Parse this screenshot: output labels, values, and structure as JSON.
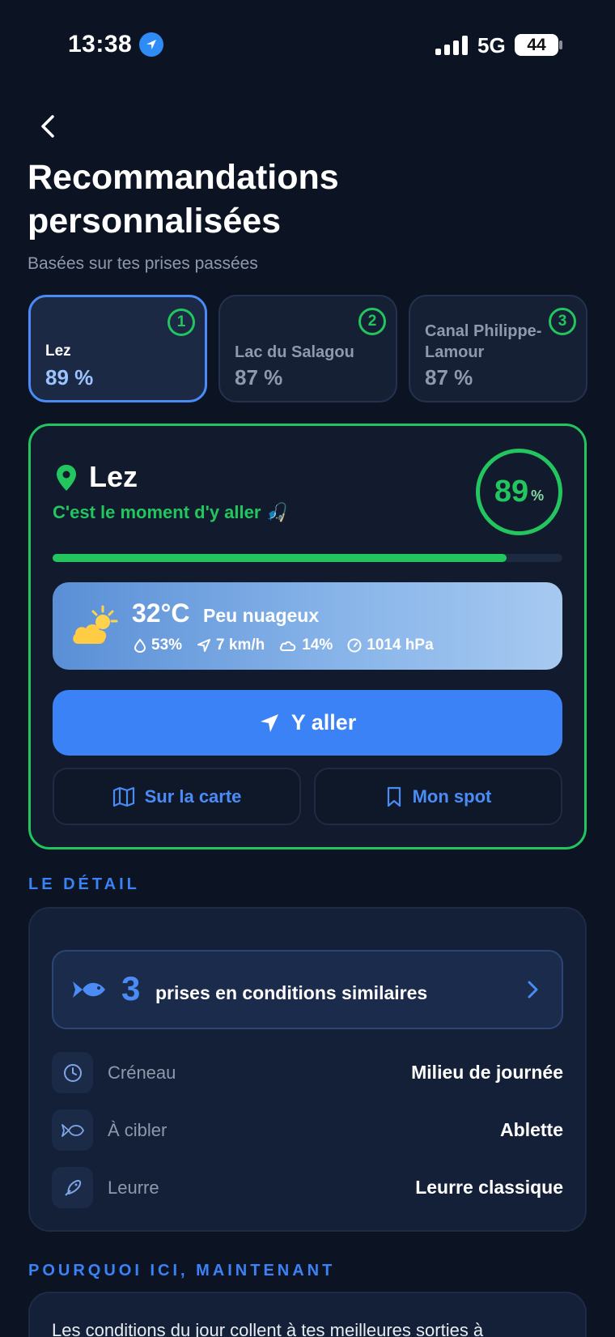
{
  "status_bar": {
    "time": "13:38",
    "network": "5G",
    "battery": "44"
  },
  "header": {
    "title": "Recommandations personnalisées",
    "subtitle": "Basées sur tes prises passées"
  },
  "spots": [
    {
      "rank": "1",
      "name": "Lez",
      "score": "89 %",
      "active": true
    },
    {
      "rank": "2",
      "name": "Lac du Salagou",
      "score": "87 %",
      "active": false
    },
    {
      "rank": "3",
      "name": "Canal Philippe-Lamour",
      "score": "87 %",
      "active": false
    }
  ],
  "selected": {
    "name": "Lez",
    "message": "C'est le moment d'y aller",
    "message_emoji": "🎣",
    "score": "89",
    "score_unit": "%",
    "progress": 0.89
  },
  "weather": {
    "temperature": "32°C",
    "description": "Peu nuageux",
    "humidity": "53%",
    "wind": "7 km/h",
    "clouds": "14%",
    "pressure": "1014 hPa"
  },
  "actions": {
    "go_label": "Y aller",
    "map_label": "Sur la carte",
    "spot_label": "Mon spot"
  },
  "detail": {
    "section_label": "LE DÉTAIL",
    "catches_count": "3",
    "catches_text": "prises en conditions similaires",
    "rows": [
      {
        "icon": "clock-icon",
        "label": "Créneau",
        "value": "Milieu de journée"
      },
      {
        "icon": "fish-icon",
        "label": "À cibler",
        "value": "Ablette"
      },
      {
        "icon": "lure-icon",
        "label": "Leurre",
        "value": "Leurre classique"
      }
    ]
  },
  "why": {
    "section_label": "POURQUOI ICI, MAINTENANT",
    "text": "Les conditions du jour collent à tes meilleures sorties à"
  },
  "colors": {
    "accent": "#3b82f6",
    "success": "#22c55e",
    "background": "#0c1424"
  }
}
